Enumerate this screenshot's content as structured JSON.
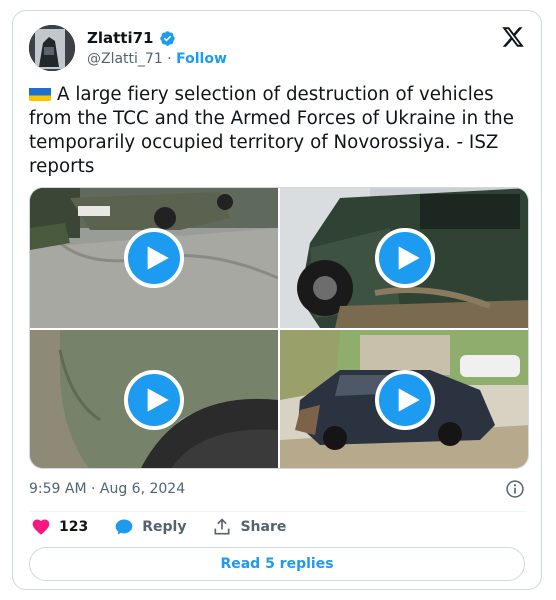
{
  "author": {
    "display_name": "Zlatti71",
    "handle": "@Zlatti_71",
    "separator": "·",
    "follow_label": "Follow"
  },
  "tweet": {
    "text": "A large fiery selection of destruction of vehicles  from the TCC and the Armed Forces of Ukraine in the temporarily occupied territory of Novorossiya. - ISZ reports",
    "timestamp": "9:59 AM · Aug 6, 2024"
  },
  "media": {
    "count": 4,
    "item_type": "video",
    "icon": "play-icon"
  },
  "actions": {
    "like_count": "123",
    "reply_label": "Reply",
    "share_label": "Share"
  },
  "read_replies_label": "Read 5 replies",
  "colors": {
    "accent": "#1d9bf0",
    "like": "#f91880",
    "text": "#0f1419",
    "muted": "#536471",
    "border": "#cfd9de"
  }
}
